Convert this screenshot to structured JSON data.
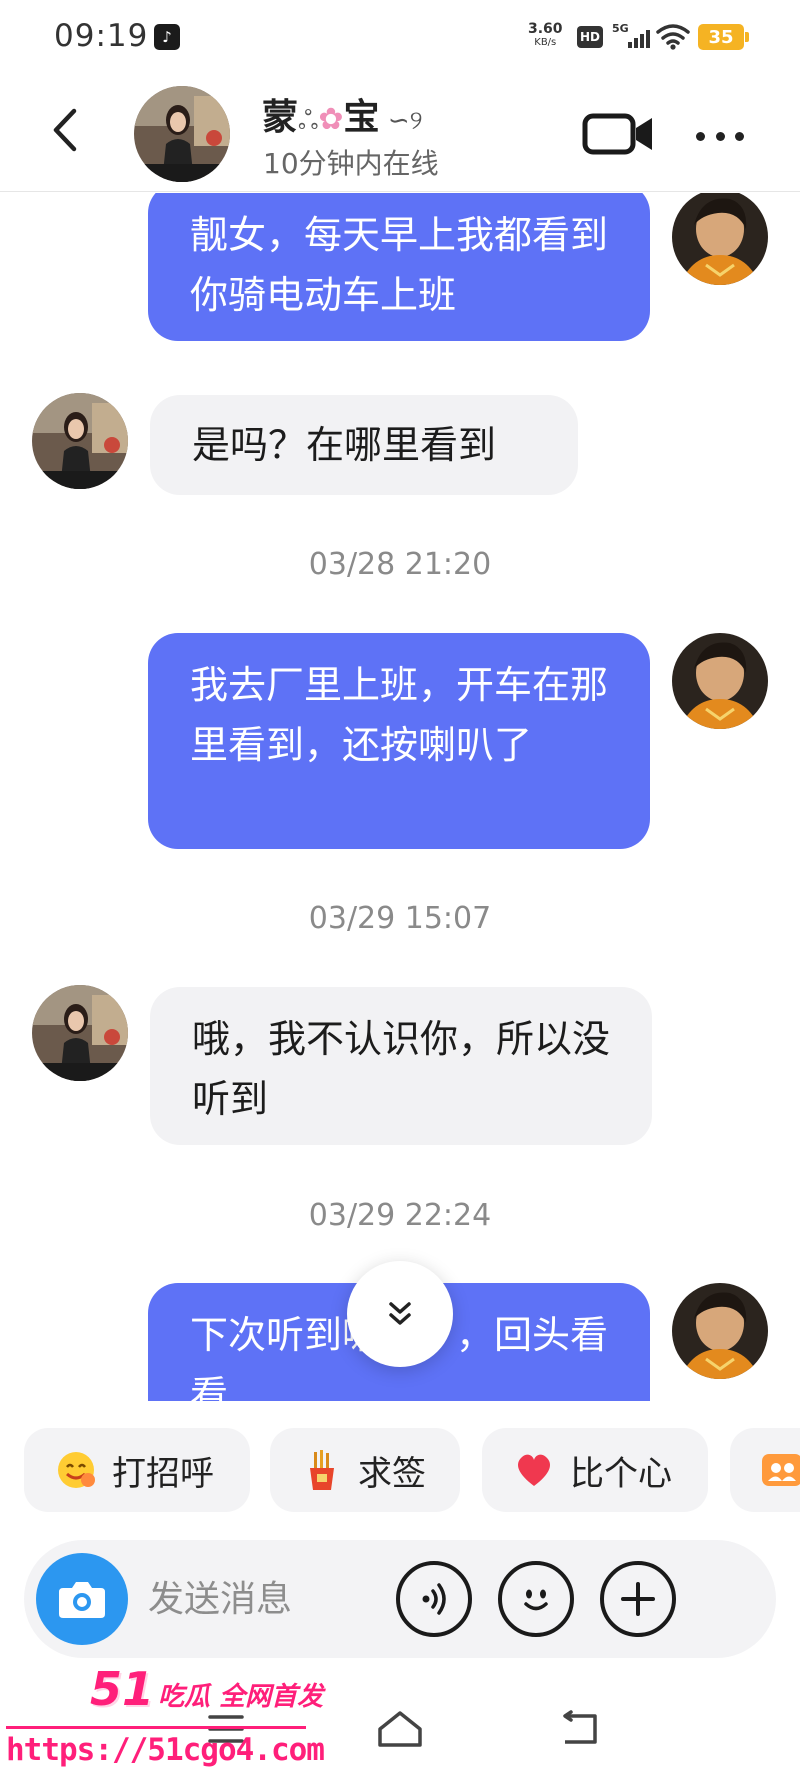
{
  "status_bar": {
    "time": "09:19",
    "app_badge": "♪",
    "net_speed": "3.60",
    "net_speed_unit": "KB/s",
    "hd": "HD",
    "network": "5G",
    "battery": "35"
  },
  "header": {
    "contact_name_part1": "蒙",
    "contact_name_part2": "宝",
    "online_status": "10分钟内在线"
  },
  "messages": [
    {
      "direction": "out",
      "text": "靓女，每天早上我都看到你骑电动车上班"
    },
    {
      "direction": "in",
      "text": "是吗？在哪里看到"
    },
    {
      "direction": "time",
      "text": "03/28 21:20"
    },
    {
      "direction": "out",
      "text": "我去厂里上班，开车在那里看到，还按喇叭了"
    },
    {
      "direction": "time",
      "text": "03/29 15:07"
    },
    {
      "direction": "in",
      "text": "哦，我不认识你，所以没听到"
    },
    {
      "direction": "time",
      "text": "03/29 22:24"
    },
    {
      "direction": "out",
      "text": "下次听到喇叭了，回头看看"
    }
  ],
  "quick_replies": [
    {
      "label": "打招呼",
      "icon": "smiley-wave-icon"
    },
    {
      "label": "求签",
      "icon": "fortune-sticks-icon"
    },
    {
      "label": "比个心",
      "icon": "heart-icon"
    },
    {
      "label": "",
      "icon": "group-icon"
    }
  ],
  "input_bar": {
    "placeholder": "发送消息"
  },
  "watermark": {
    "brand_number": "51",
    "brand_text": "吃瓜 全网首发",
    "url": "https://51cgo4.com"
  },
  "colors": {
    "outgoing_bubble": "#5e72f6",
    "incoming_bubble": "#f2f2f4",
    "camera_button": "#2c97f0",
    "battery": "#f5b323",
    "watermark": "#ff1f7a"
  }
}
